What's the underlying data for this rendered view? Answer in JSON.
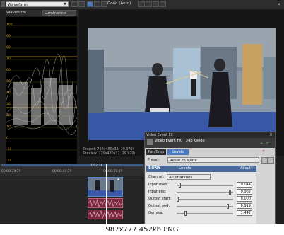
{
  "scope": {
    "mode_select": "Waveform",
    "channel_select": "Luminance",
    "title": "Waveform",
    "scale_labels": [
      "100",
      "90",
      "80",
      "70",
      "60",
      "50",
      "40",
      "30",
      "20",
      "10",
      "0",
      "-10",
      "-20"
    ]
  },
  "preview": {
    "quality_select": "Good (Auto)",
    "project_info": "Project:  720x480x32, 29.970i",
    "preview_info": "Preview:  720x480x32, 29.970i"
  },
  "timeline": {
    "ruler_labels": [
      "00:00:29:29",
      "00:00:44:29",
      "00:00:59:29"
    ],
    "marker_text": "1:02:18"
  },
  "fx": {
    "window_title": "Video Event FX",
    "header_label": "Video Event FX:",
    "event_name": "24p Kendo",
    "tabs": [
      "Pan/Crop",
      "Levels"
    ],
    "preset_label": "Preset:",
    "preset_value": "Reset to None",
    "brand": "SONY",
    "plugin_name": "Levels",
    "about": "About",
    "help": "?",
    "channel_label": "Channel:",
    "channel_value": "All channels",
    "params": [
      {
        "label": "Input start:",
        "value": "0.044",
        "level": 0.044
      },
      {
        "label": "Input end:",
        "value": "0.962",
        "level": 0.962
      },
      {
        "label": "Output start:",
        "value": "0.000",
        "level": 0.0
      },
      {
        "label": "Output end:",
        "value": "0.919",
        "level": 0.919
      },
      {
        "label": "Gamma:",
        "value": "1.442",
        "level": 0.144
      }
    ]
  },
  "caption": "987x777  452kb  PNG",
  "colors": {
    "app_bg": "#1e1e1e",
    "panel_bg": "#2a2a2a",
    "fx_header": "#3a6ea5",
    "accent": "#4a7cc0"
  }
}
